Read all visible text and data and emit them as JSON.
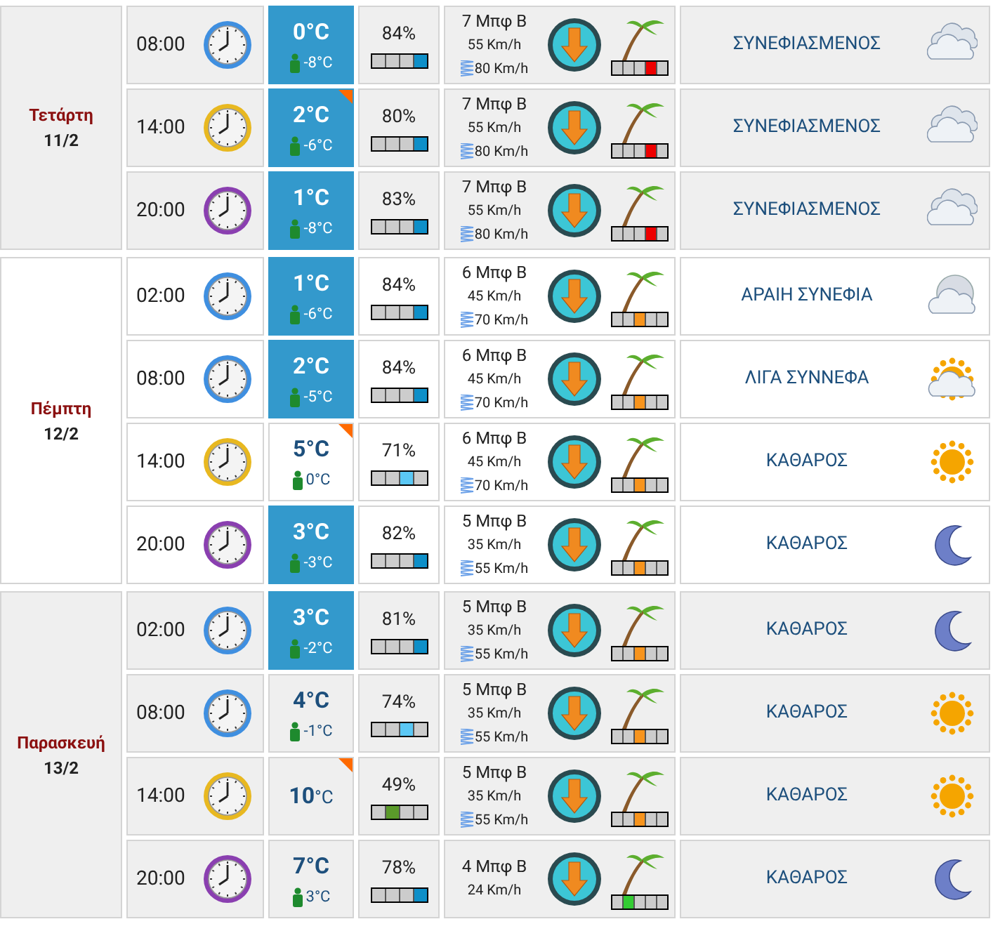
{
  "days": [
    {
      "name": "Τετάρτη",
      "date": "11/2",
      "shaded": true,
      "rows": [
        {
          "time": "08:00",
          "color": "#3f8fe0",
          "temp": "0°C",
          "cold": true,
          "flag": false,
          "feels": "-8°C",
          "humidity": "84%",
          "humidity_segments": [
            {
              "selected": false
            },
            {
              "selected": false
            },
            {
              "selected": false
            },
            {
              "selected": true
            }
          ],
          "beaufort": "7 Μπφ Β",
          "speed": "55 Km/h",
          "gust": "80 Km/h",
          "wind_segments": [
            {
              "selected": false
            },
            {
              "selected": false
            },
            {
              "selected": false
            },
            {
              "selected": true
            },
            {
              "selected": false
            }
          ],
          "sky": "ΣΥΝΕΦΙΑΣΜΕΝΟΣ",
          "kind": "clouds"
        },
        {
          "time": "14:00",
          "color": "#e8b820",
          "temp": "2°C",
          "cold": true,
          "flag": true,
          "feels": "-6°C",
          "humidity": "80%",
          "humidity_segments": [
            {
              "selected": false
            },
            {
              "selected": false
            },
            {
              "selected": false
            },
            {
              "selected": true
            }
          ],
          "beaufort": "7 Μπφ Β",
          "speed": "55 Km/h",
          "gust": "80 Km/h",
          "wind_segments": [
            {
              "selected": false
            },
            {
              "selected": false
            },
            {
              "selected": false
            },
            {
              "selected": true
            },
            {
              "selected": false
            }
          ],
          "sky": "ΣΥΝΕΦΙΑΣΜΕΝΟΣ",
          "kind": "clouds"
        },
        {
          "time": "20:00",
          "color": "#8a3fb0",
          "temp": "1°C",
          "cold": true,
          "flag": false,
          "feels": "-8°C",
          "humidity": "83%",
          "humidity_segments": [
            {
              "selected": false
            },
            {
              "selected": false
            },
            {
              "selected": false
            },
            {
              "selected": true
            }
          ],
          "beaufort": "7 Μπφ Β",
          "speed": "55 Km/h",
          "gust": "80 Km/h",
          "wind_segments": [
            {
              "selected": false
            },
            {
              "selected": false
            },
            {
              "selected": false
            },
            {
              "selected": true
            },
            {
              "selected": false
            }
          ],
          "sky": "ΣΥΝΕΦΙΑΣΜΕΝΟΣ",
          "kind": "clouds"
        }
      ]
    },
    {
      "name": "Πέμπτη",
      "date": "12/2",
      "shaded": false,
      "rows": [
        {
          "time": "02:00",
          "color": "#3f8fe0",
          "temp": "1°C",
          "cold": true,
          "flag": false,
          "feels": "-6°C",
          "humidity": "84%",
          "humidity_segments": [
            {
              "selected": false
            },
            {
              "selected": false
            },
            {
              "selected": false
            },
            {
              "selected": true
            }
          ],
          "beaufort": "6 Μπφ Β",
          "speed": "45 Km/h",
          "gust": "70 Km/h",
          "wind_segments": [
            {
              "selected": false
            },
            {
              "selected": false
            },
            {
              "selected": true
            },
            {
              "selected": false
            },
            {
              "selected": false
            }
          ],
          "sky": "ΑΡΑΙΗ ΣΥΝΕΦΙΑ",
          "kind": "moon-cloud"
        },
        {
          "time": "08:00",
          "color": "#3f8fe0",
          "temp": "2°C",
          "cold": true,
          "flag": false,
          "feels": "-5°C",
          "humidity": "84%",
          "humidity_segments": [
            {
              "selected": false
            },
            {
              "selected": false
            },
            {
              "selected": false
            },
            {
              "selected": true
            }
          ],
          "beaufort": "6 Μπφ Β",
          "speed": "45 Km/h",
          "gust": "70 Km/h",
          "wind_segments": [
            {
              "selected": false
            },
            {
              "selected": false
            },
            {
              "selected": true
            },
            {
              "selected": false
            },
            {
              "selected": false
            }
          ],
          "sky": "ΛΙΓΑ ΣΥΝΝΕΦΑ",
          "kind": "sun-cloud"
        },
        {
          "time": "14:00",
          "color": "#e8b820",
          "temp": "5°C",
          "cold": false,
          "flag": true,
          "feels": "0°C",
          "humidity": "71%",
          "humidity_segments": [
            {
              "selected": false
            },
            {
              "selected": false
            },
            {
              "selected": true
            },
            {
              "selected": false
            }
          ],
          "beaufort": "6 Μπφ Β",
          "speed": "45 Km/h",
          "gust": "70 Km/h",
          "wind_segments": [
            {
              "selected": false
            },
            {
              "selected": false
            },
            {
              "selected": true
            },
            {
              "selected": false
            },
            {
              "selected": false
            }
          ],
          "sky": "ΚΑΘΑΡΟΣ",
          "kind": "sun"
        },
        {
          "time": "20:00",
          "color": "#8a3fb0",
          "temp": "3°C",
          "cold": true,
          "flag": false,
          "feels": "-3°C",
          "humidity": "82%",
          "humidity_segments": [
            {
              "selected": false
            },
            {
              "selected": false
            },
            {
              "selected": false
            },
            {
              "selected": true
            }
          ],
          "beaufort": "5 Μπφ Β",
          "speed": "35 Km/h",
          "gust": "55 Km/h",
          "wind_segments": [
            {
              "selected": false
            },
            {
              "selected": false
            },
            {
              "selected": true
            },
            {
              "selected": false
            },
            {
              "selected": false
            }
          ],
          "sky": "ΚΑΘΑΡΟΣ",
          "kind": "moon"
        }
      ]
    },
    {
      "name": "Παρασκευή",
      "date": "13/2",
      "shaded": true,
      "rows": [
        {
          "time": "02:00",
          "color": "#3f8fe0",
          "temp": "3°C",
          "cold": true,
          "flag": false,
          "feels": "-2°C",
          "humidity": "81%",
          "humidity_segments": [
            {
              "selected": false
            },
            {
              "selected": false
            },
            {
              "selected": false
            },
            {
              "selected": true
            }
          ],
          "beaufort": "5 Μπφ Β",
          "speed": "35 Km/h",
          "gust": "55 Km/h",
          "wind_segments": [
            {
              "selected": false
            },
            {
              "selected": false
            },
            {
              "selected": true
            },
            {
              "selected": false
            },
            {
              "selected": false
            }
          ],
          "sky": "ΚΑΘΑΡΟΣ",
          "kind": "moon"
        },
        {
          "time": "08:00",
          "color": "#3f8fe0",
          "temp": "4°C",
          "cold": false,
          "flag": false,
          "feels": "-1°C",
          "humidity": "74%",
          "humidity_segments": [
            {
              "selected": false
            },
            {
              "selected": false
            },
            {
              "selected": true
            },
            {
              "selected": false
            }
          ],
          "beaufort": "5 Μπφ Β",
          "speed": "35 Km/h",
          "gust": "55 Km/h",
          "wind_segments": [
            {
              "selected": false
            },
            {
              "selected": false
            },
            {
              "selected": true
            },
            {
              "selected": false
            },
            {
              "selected": false
            }
          ],
          "sky": "ΚΑΘΑΡΟΣ",
          "kind": "sun"
        },
        {
          "time": "14:00",
          "color": "#e8b820",
          "temp": "10",
          "unit": "°C",
          "cold": false,
          "flag": true,
          "humidity": "49%",
          "humidity_segments": [
            {
              "selected": false
            },
            {
              "selected": true
            },
            {
              "selected": false
            },
            {
              "selected": false
            }
          ],
          "beaufort": "5 Μπφ Β",
          "speed": "35 Km/h",
          "gust": "55 Km/h",
          "wind_segments": [
            {
              "selected": false
            },
            {
              "selected": false
            },
            {
              "selected": true
            },
            {
              "selected": false
            },
            {
              "selected": false
            }
          ],
          "sky": "ΚΑΘΑΡΟΣ",
          "kind": "sun"
        },
        {
          "time": "20:00",
          "color": "#8a3fb0",
          "temp": "7°C",
          "cold": false,
          "flag": false,
          "feels": "3°C",
          "humidity": "78%",
          "humidity_segments": [
            {
              "selected": false
            },
            {
              "selected": false
            },
            {
              "selected": false
            },
            {
              "selected": true
            }
          ],
          "beaufort": "4 Μπφ Β",
          "speed": "24 Km/h",
          "wind_segments": [
            {
              "selected": false
            },
            {
              "selected": true
            },
            {
              "selected": false
            },
            {
              "selected": false
            },
            {
              "selected": false
            }
          ],
          "sky": "ΚΑΘΑΡΟΣ",
          "kind": "moon"
        }
      ]
    }
  ]
}
